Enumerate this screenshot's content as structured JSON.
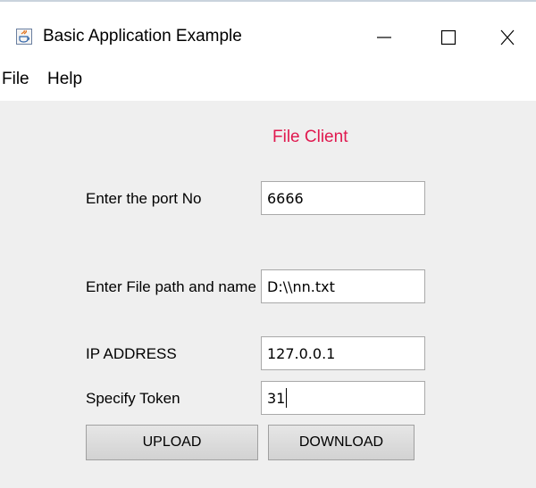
{
  "window": {
    "title": "Basic Application Example",
    "app_icon": "java-icon",
    "controls": [
      "minimize-icon",
      "maximize-icon",
      "close-icon"
    ]
  },
  "menu": {
    "items": [
      {
        "label": "File"
      },
      {
        "label": "Help"
      }
    ]
  },
  "form": {
    "heading": "File Client",
    "heading_color": "#e0194f",
    "port": {
      "label": "Enter the port No",
      "value": "6666"
    },
    "filepath": {
      "label": "Enter File path and name",
      "value": "D:\\\\nn.txt"
    },
    "ip": {
      "label": "IP ADDRESS",
      "value": "127.0.0.1"
    },
    "token": {
      "label": "Specify Token",
      "value": "31"
    }
  },
  "buttons": {
    "upload": "UPLOAD",
    "download": "DOWNLOAD"
  }
}
